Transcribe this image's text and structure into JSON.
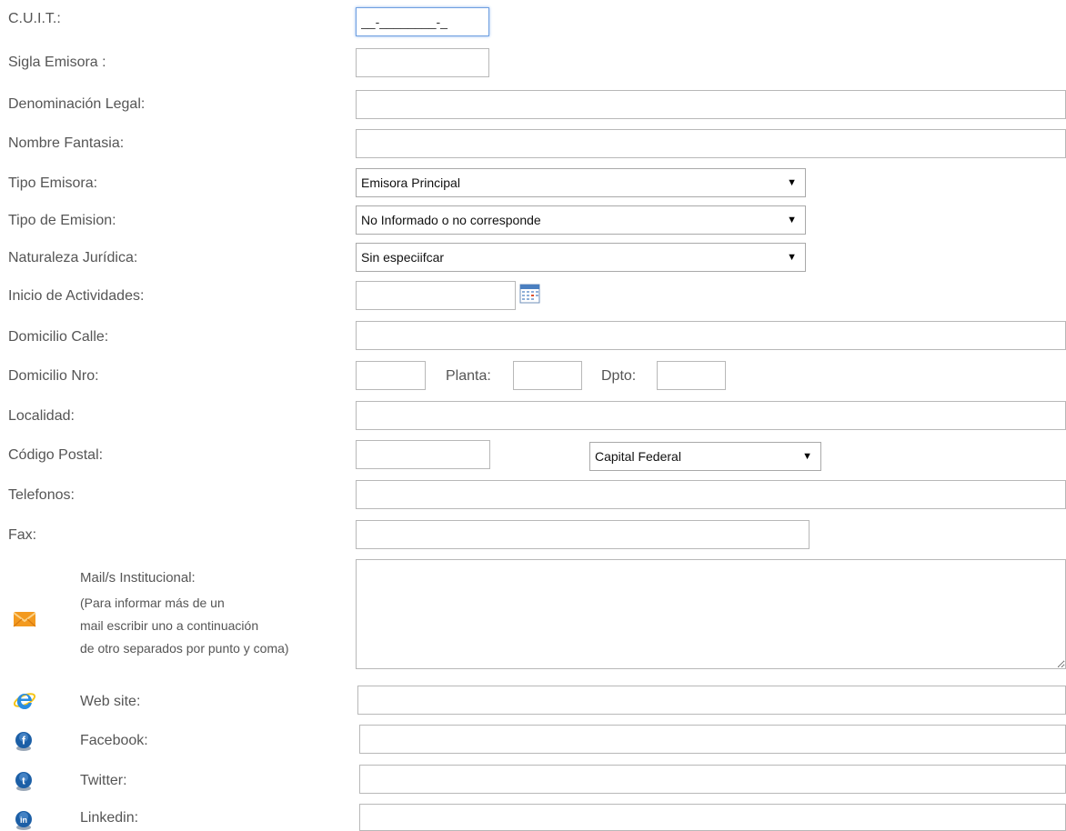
{
  "form": {
    "cuit": {
      "label": "C.U.I.T.:",
      "value": "__-________-_"
    },
    "sigla": {
      "label": "Sigla Emisora :",
      "value": ""
    },
    "denominacion": {
      "label": "Denominación Legal:",
      "value": ""
    },
    "nombre_fantasia": {
      "label": "Nombre Fantasia:",
      "value": ""
    },
    "tipo_emisora": {
      "label": "Tipo Emisora:",
      "selected": "Emisora Principal"
    },
    "tipo_emision": {
      "label": "Tipo de Emision:",
      "selected": "No Informado o no corresponde"
    },
    "naturaleza": {
      "label": "Naturaleza Jurídica:",
      "selected": "Sin especiifcar"
    },
    "inicio_actividades": {
      "label": "Inicio de Actividades:",
      "value": "",
      "icon": "calendar-icon"
    },
    "domicilio_calle": {
      "label": "Domicilio Calle:",
      "value": ""
    },
    "domicilio_nro": {
      "label": "Domicilio Nro:",
      "value": ""
    },
    "planta": {
      "label": "Planta:",
      "value": ""
    },
    "dpto": {
      "label": "Dpto:",
      "value": ""
    },
    "localidad": {
      "label": "Localidad:",
      "value": ""
    },
    "codigo_postal": {
      "label": "Código Postal:",
      "value": ""
    },
    "provincia": {
      "selected": "Capital Federal"
    },
    "telefonos": {
      "label": "Telefonos:",
      "value": ""
    },
    "fax": {
      "label": "Fax:",
      "value": ""
    },
    "mail": {
      "label": "Mail/s Institucional:",
      "hint_line1": "(Para informar más de un",
      "hint_line2": "mail escribir uno a continuación",
      "hint_line3": "de otro separados por punto y coma)",
      "value": "",
      "icon": "envelope-icon"
    },
    "web_site": {
      "label": "Web site:",
      "value": "",
      "icon": "internet-explorer-icon"
    },
    "facebook": {
      "label": "Facebook:",
      "value": "",
      "icon": "facebook-icon"
    },
    "twitter": {
      "label": "Twitter:",
      "value": "",
      "icon": "twitter-icon"
    },
    "linkedin": {
      "label": "Linkedin:",
      "value": "",
      "icon": "linkedin-icon"
    }
  },
  "colors": {
    "label_text": "#555555",
    "input_border": "#b8b8b8",
    "focus_border": "#6f9fe0",
    "social_blue": "#1c5fa6"
  }
}
